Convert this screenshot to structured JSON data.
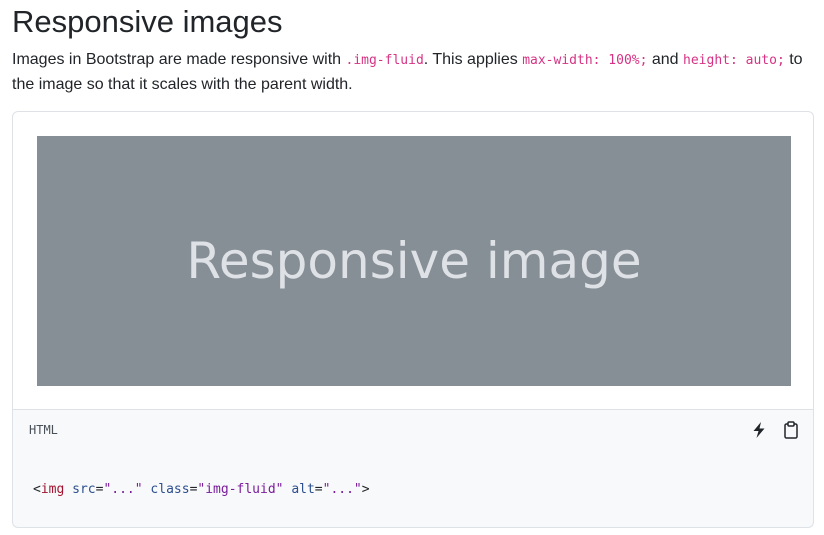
{
  "heading": "Responsive images",
  "description": {
    "part1": "Images in Bootstrap are made responsive with ",
    "code1": ".img-fluid",
    "part2": ". This applies ",
    "code2": "max-width: 100%;",
    "part3": " and ",
    "code3": "height: auto;",
    "part4": " to the image so that it scales with the parent width."
  },
  "example": {
    "placeholder_text": "Responsive image",
    "placeholder_bg": "#868e96",
    "placeholder_fg": "#dee2e6"
  },
  "code_block": {
    "language": "HTML",
    "icons": [
      "lightning-icon",
      "clipboard-icon"
    ],
    "tokens": {
      "open": "<",
      "tag": "img",
      "attr1": "src",
      "eq1": "=",
      "val1": "\"...\"",
      "attr2": "class",
      "eq2": "=",
      "val2": "\"img-fluid\"",
      "attr3": "alt",
      "eq3": "=",
      "val3": "\"...\"",
      "close": ">"
    }
  },
  "colors": {
    "inline_code": "#d63384",
    "border": "#dee2e6",
    "code_bg": "#f8f9fa"
  }
}
